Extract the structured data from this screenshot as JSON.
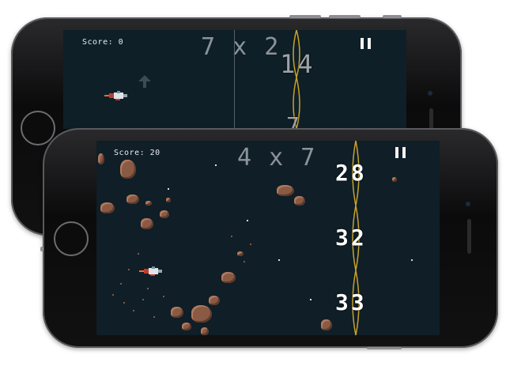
{
  "back_game": {
    "score": "Score: 0",
    "problem": "7 x 2",
    "answers": [
      "14",
      "7"
    ]
  },
  "front_game": {
    "score": "Score: 20",
    "problem": "4 x 7",
    "answers": [
      "28",
      "32",
      "33"
    ]
  },
  "icons": {
    "pause": "pause-icon",
    "ship": "spaceship-icon"
  },
  "colors": {
    "background": "#0f1e27",
    "gate": "#c9a227",
    "asteroid": "#8a5a44",
    "phone_body": "#111111"
  }
}
